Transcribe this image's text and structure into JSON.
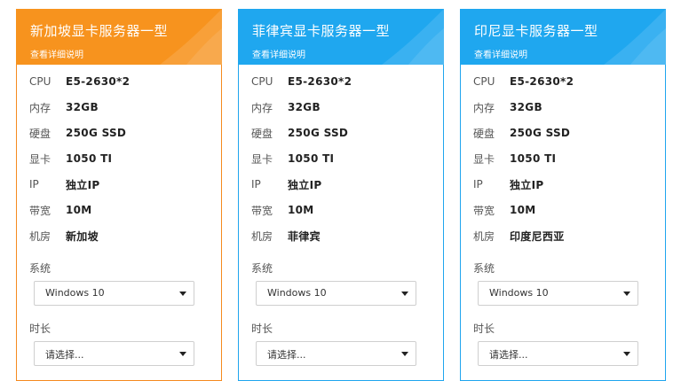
{
  "cards": [
    {
      "title": "新加坡显卡服务器一型",
      "detail_link": "查看详细说明",
      "specs": [
        {
          "key": "CPU",
          "value": "E5-2630*2"
        },
        {
          "key": "内存",
          "value": "32GB"
        },
        {
          "key": "硬盘",
          "value": "250G SSD"
        },
        {
          "key": "显卡",
          "value": "1050 TI"
        },
        {
          "key": "IP",
          "value": "独立IP"
        },
        {
          "key": "带宽",
          "value": "10M"
        },
        {
          "key": "机房",
          "value": "新加坡"
        }
      ],
      "system_label": "系统",
      "system_value": "Windows 10",
      "duration_label": "时长",
      "duration_value": "请选择..."
    },
    {
      "title": "菲律宾显卡服务器一型",
      "detail_link": "查看详细说明",
      "specs": [
        {
          "key": "CPU",
          "value": "E5-2630*2"
        },
        {
          "key": "内存",
          "value": "32GB"
        },
        {
          "key": "硬盘",
          "value": "250G SSD"
        },
        {
          "key": "显卡",
          "value": "1050 TI"
        },
        {
          "key": "IP",
          "value": "独立IP"
        },
        {
          "key": "带宽",
          "value": "10M"
        },
        {
          "key": "机房",
          "value": "菲律宾"
        }
      ],
      "system_label": "系统",
      "system_value": "Windows 10",
      "duration_label": "时长",
      "duration_value": "请选择..."
    },
    {
      "title": "印尼显卡服务器一型",
      "detail_link": "查看详细说明",
      "specs": [
        {
          "key": "CPU",
          "value": "E5-2630*2"
        },
        {
          "key": "内存",
          "value": "32GB"
        },
        {
          "key": "硬盘",
          "value": "250G SSD"
        },
        {
          "key": "显卡",
          "value": "1050 TI"
        },
        {
          "key": "IP",
          "value": "独立IP"
        },
        {
          "key": "带宽",
          "value": "10M"
        },
        {
          "key": "机房",
          "value": "印度尼西亚"
        }
      ],
      "system_label": "系统",
      "system_value": "Windows 10",
      "duration_label": "时长",
      "duration_value": "请选择..."
    }
  ],
  "colors": {
    "orange_header": "#f7931e",
    "blue_header": "#1fa7ef"
  },
  "icons": {
    "select_arrow": "caret-down-icon"
  }
}
